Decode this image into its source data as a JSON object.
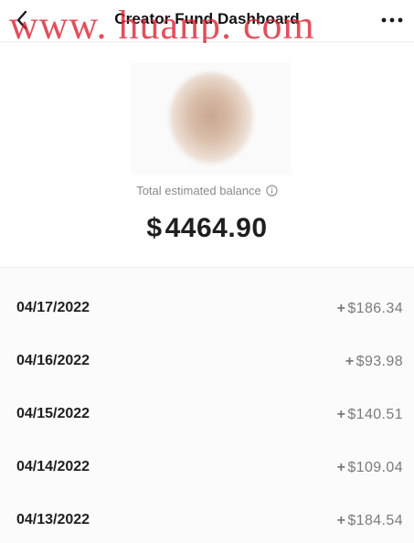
{
  "header": {
    "title": "Creator Fund Dashboard",
    "back_icon": "chevron-left-icon",
    "more_icon": "more-horizontal-icon"
  },
  "watermark": "www. huanp. com",
  "balance": {
    "label": "Total estimated balance",
    "currency": "$",
    "value": "4464.90"
  },
  "transactions": [
    {
      "date": "04/17/2022",
      "sign": "+",
      "currency": "$",
      "amount": "186.34"
    },
    {
      "date": "04/16/2022",
      "sign": "+",
      "currency": "$",
      "amount": "93.98"
    },
    {
      "date": "04/15/2022",
      "sign": "+",
      "currency": "$",
      "amount": "140.51"
    },
    {
      "date": "04/14/2022",
      "sign": "+",
      "currency": "$",
      "amount": "109.04"
    },
    {
      "date": "04/13/2022",
      "sign": "+",
      "currency": "$",
      "amount": "184.54"
    }
  ],
  "colors": {
    "watermark": "#d82434",
    "text_primary": "#1f1f1f",
    "text_secondary": "#8a8a8a"
  }
}
